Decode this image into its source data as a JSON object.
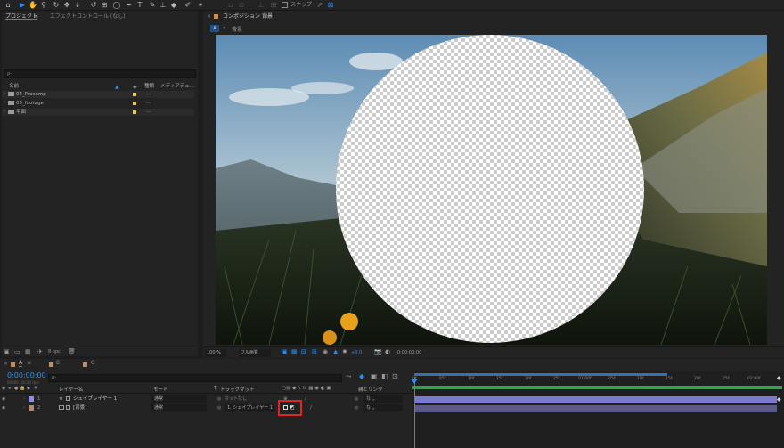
{
  "tabs": {
    "project": "プロジェクト",
    "effects": "エフェクトコントロール (なし)",
    "composition": "コンポジション",
    "comp_name": "背景",
    "comp_badge": "A"
  },
  "toolbar": {
    "snap": "スナップ"
  },
  "project_panel": {
    "search_placeholder": "ρ-",
    "col_name": "名前",
    "col_type": "種類",
    "col_media": "メディアデュ...",
    "items": [
      {
        "name": "04_Precomp",
        "type": "---"
      },
      {
        "name": "05_footage",
        "type": "---"
      },
      {
        "name": "平面",
        "type": "---"
      }
    ],
    "bpc": "8 bpc"
  },
  "viewer": {
    "zoom": "100 %",
    "quality": "フル画質",
    "exposure": "+0.0",
    "timecode": "0:00:00:00"
  },
  "timeline": {
    "tabs": [
      "A",
      "B",
      "C"
    ],
    "timecode": "0:00:00:00",
    "fps": "00000 (30.00 fps)",
    "search_placeholder": "ρ-",
    "col_layer_name": "レイヤー名",
    "col_mode": "モード",
    "col_t": "T",
    "col_trackmatte": "トラックマット",
    "col_parent": "親とリンク",
    "layers": [
      {
        "num": "1",
        "name": "シェイプレイヤー 1",
        "mode": "通常",
        "matte": "マットなし",
        "parent": "なし",
        "color": "#8e8ee8"
      },
      {
        "num": "2",
        "name": "[背景]",
        "mode": "通常",
        "matte": "1. シェイプレイヤー 1",
        "parent": "なし",
        "color": "#b58a6a"
      }
    ],
    "ruler": [
      "0f",
      "05f",
      "10f",
      "15f",
      "20f",
      "25f",
      "01:00f",
      "05f",
      "10f",
      "15f",
      "20f",
      "25f",
      "02:00f"
    ]
  },
  "colors": {
    "accent": "#2d8ceb",
    "highlight": "#e02525",
    "label_yellow": "#e8d23c"
  }
}
